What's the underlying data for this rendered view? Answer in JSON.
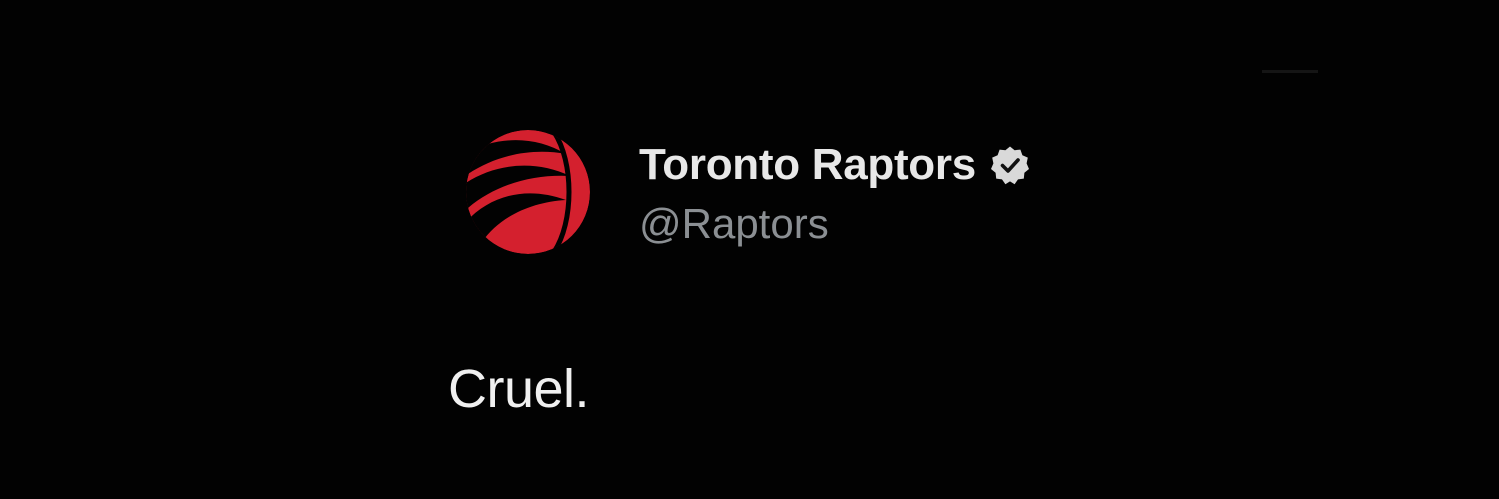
{
  "tweet": {
    "author": {
      "display_name": "Toronto Raptors",
      "handle": "@Raptors",
      "verified": true,
      "avatar_icon": "raptors-claw-ball-logo-icon",
      "verified_icon": "verified-badge-icon"
    },
    "text": "Cruel."
  },
  "colors": {
    "background": "#000000",
    "name_text": "#e8e8e8",
    "handle_text": "#8b8f93",
    "body_text": "#f0f0f0",
    "logo_red": "#ce1141",
    "badge_fill": "#d9d9d9"
  }
}
